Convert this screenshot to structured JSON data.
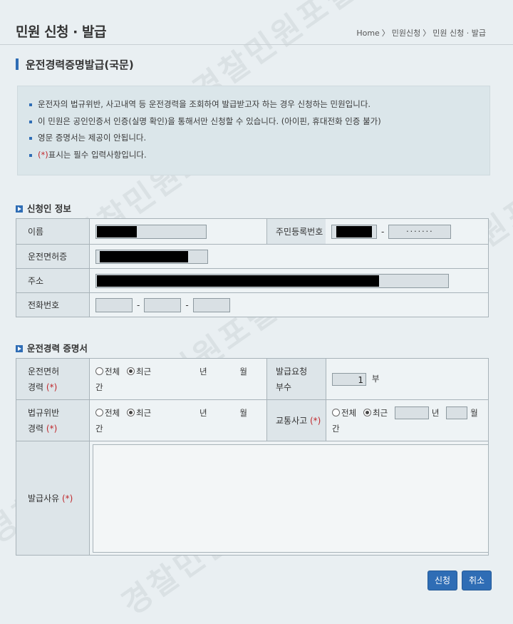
{
  "header": {
    "title": "민원 신청 · 발급",
    "breadcrumb": [
      "Home",
      "〉",
      "민원신청",
      "〉",
      "민원 신청 · 발급"
    ]
  },
  "page": {
    "section_title": "운전경력증명발급(국문)",
    "notices": [
      "운전자의 법규위반, 사고내역 등 운전경력을 조회하여 발급받고자 하는 경우 신청하는 민원입니다.",
      "이 민원은 공인인증서 인증(실명 확인)을 통해서만 신청할 수 있습니다. (아이핀, 휴대전화 인증 불가)",
      "영문 증명서는 제공이 안됩니다."
    ],
    "required_note_mark": "(*)",
    "required_note_text": "표시는 필수 입력사항입니다."
  },
  "applicant": {
    "title": "신청인 정보",
    "name_label": "이름",
    "rrn_label": "주민등록번호",
    "rrn_back_masked": "·······",
    "license_label": "운전면허증",
    "address_label": "주소",
    "phone_label": "전화번호",
    "dash": "-"
  },
  "certificate": {
    "title": "운전경력 증명서",
    "license_history_label": "운전면허",
    "license_history_label2": "경력",
    "violation_label": "법규위반",
    "violation_label2": "경력",
    "accident_label": "교통사고",
    "copies_label": "발급요청",
    "copies_label2": "부수",
    "copies_value": "1",
    "copies_unit": "부",
    "reason_label": "발급사유",
    "req_mark": "(*)",
    "opt_all": "전체",
    "opt_recent": "최근",
    "unit_year": "년",
    "unit_month": "월",
    "unit_period": "간"
  },
  "buttons": {
    "submit": "신청",
    "cancel": "취소"
  },
  "watermark": "경찰민원포털",
  "colors": {
    "accent": "#2f6db5",
    "required": "#c0282c"
  }
}
